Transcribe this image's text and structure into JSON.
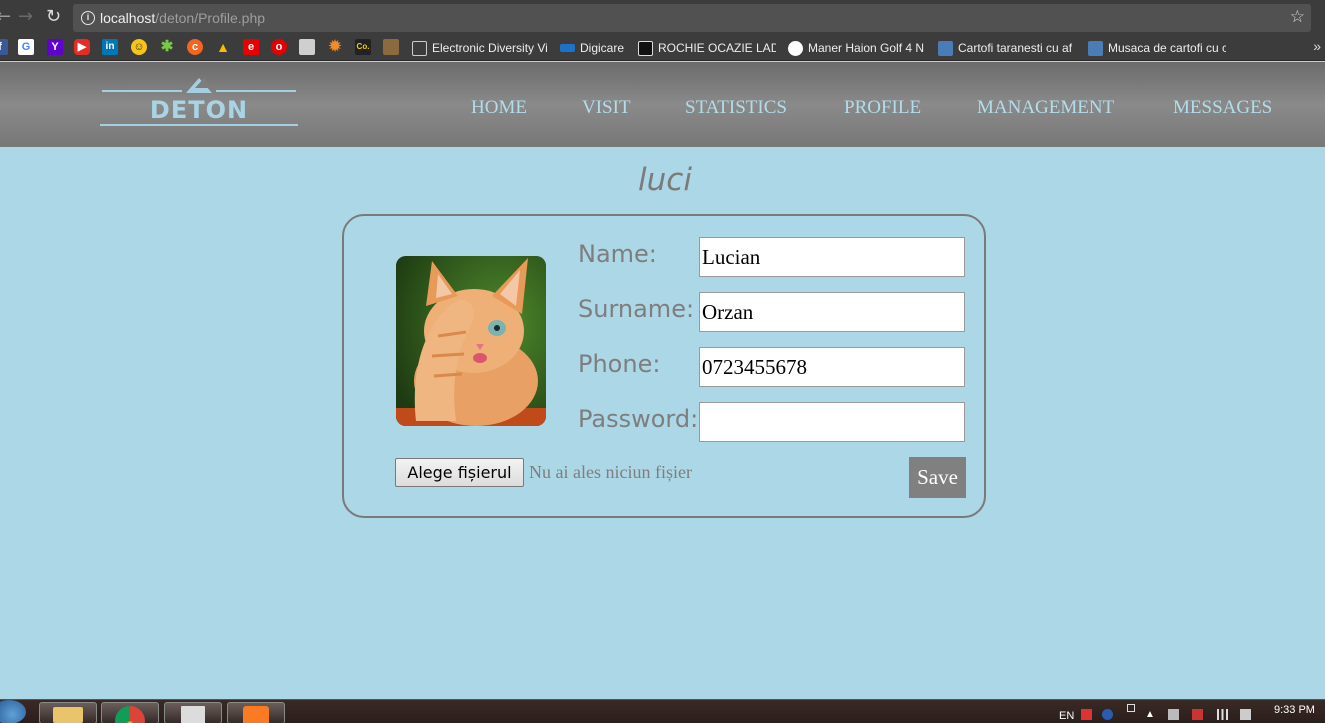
{
  "browser": {
    "url_host": "localhost",
    "url_path": "/deton/Profile.php",
    "back_icon": "back-arrow-icon",
    "forward_icon": "forward-arrow-icon",
    "reload_icon": "reload-icon",
    "bookmarks": [
      {
        "label": "Electronic Diversity Vi",
        "icon": "page-icon"
      },
      {
        "label": "Digicare",
        "icon": "digicare-icon"
      },
      {
        "label": "ROCHIE OCAZIE LADY",
        "icon": "tf-icon"
      },
      {
        "label": "Maner Haion Golf 4 N",
        "icon": "olx-icon"
      },
      {
        "label": "Cartofi taranesti cu af",
        "icon": "food-icon"
      },
      {
        "label": "Musaca de cartofi cu c",
        "icon": "food-icon"
      }
    ],
    "more_label": "»"
  },
  "site": {
    "logo_text": "DETON",
    "nav": [
      "HOME",
      "VISIT",
      "STATISTICS",
      "PROFILE",
      "MANAGEMENT",
      "MESSAGES"
    ]
  },
  "profile": {
    "username": "luci",
    "fields": {
      "name_label": "Name:",
      "name_value": "Lucian",
      "surname_label": "Surname:",
      "surname_value": "Orzan",
      "phone_label": "Phone:",
      "phone_value": "0723455678",
      "password_label": "Password:",
      "password_value": ""
    },
    "file_button": "Alege fișierul",
    "file_status": "Nu ai ales niciun fișier",
    "save_button": "Save"
  },
  "taskbar": {
    "lang": "EN",
    "time": "9:33 PM"
  }
}
